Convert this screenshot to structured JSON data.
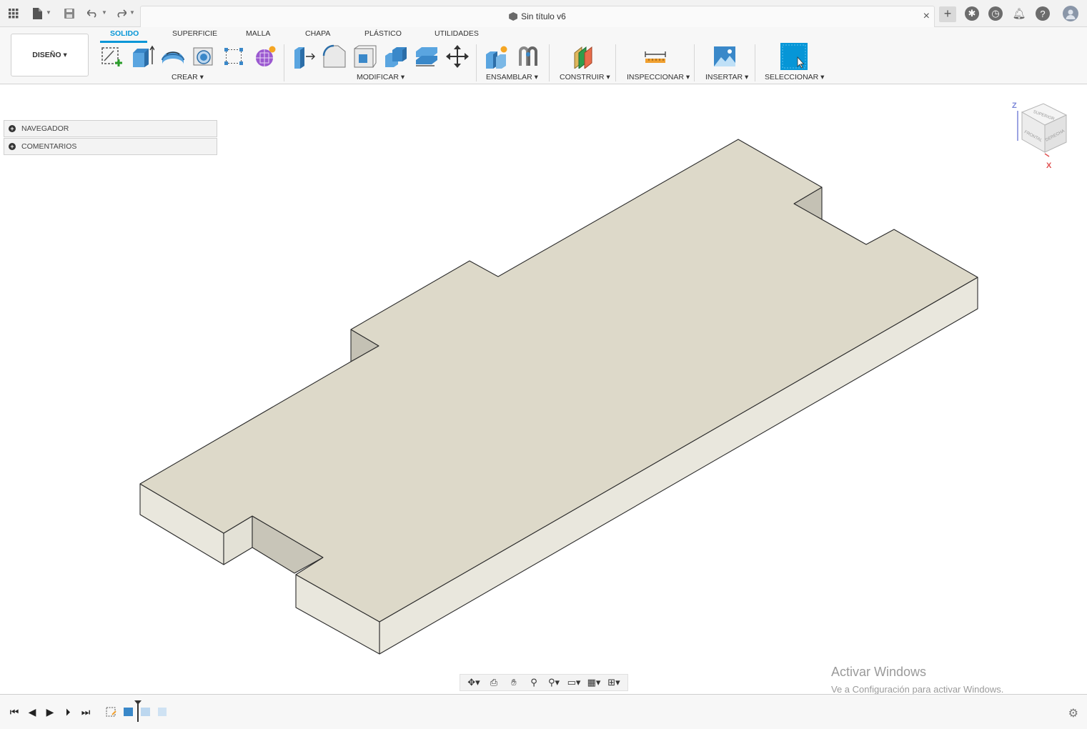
{
  "document": {
    "title": "Sin título v6"
  },
  "ribbon": {
    "workspace_label": "DISEÑO ▾",
    "tabs": [
      {
        "label": "SOLIDO",
        "active": true
      },
      {
        "label": "SUPERFICIE"
      },
      {
        "label": "MALLA"
      },
      {
        "label": "CHAPA"
      },
      {
        "label": "PLÁSTICO"
      },
      {
        "label": "UTILIDADES"
      }
    ],
    "groups": {
      "crear": "CREAR ▾",
      "modificar": "MODIFICAR ▾",
      "ensamblar": "ENSAMBLAR ▾",
      "construir": "CONSTRUIR ▾",
      "inspeccionar": "INSPECCIONAR ▾",
      "insertar": "INSERTAR ▾",
      "seleccionar": "SELECCIONAR ▾"
    }
  },
  "browser": {
    "navigator": "NAVEGADOR",
    "comments": "COMENTARIOS"
  },
  "viewcube": {
    "top": "SUPERIOR",
    "front": "FRONTAL",
    "right": "DERECHA",
    "axis_z": "Z",
    "axis_x": "X"
  },
  "watermark": {
    "line1": "Activar Windows",
    "line2": "Ve a Configuración para activar Windows."
  },
  "colors": {
    "accent": "#0696d7",
    "part_top": "#ddd9c9",
    "part_side": "#e9e7dd"
  }
}
